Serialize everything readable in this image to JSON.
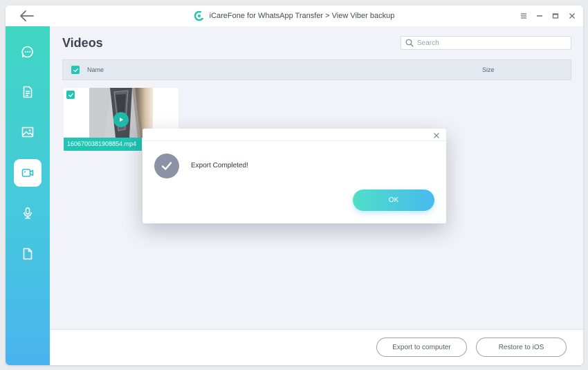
{
  "window": {
    "title": "iCareFone for WhatsApp Transfer > View Viber backup"
  },
  "sidebar": {
    "items": [
      {
        "name": "chats",
        "icon": "chat-bubble-icon",
        "active": false
      },
      {
        "name": "documents",
        "icon": "document-icon",
        "active": false
      },
      {
        "name": "photos",
        "icon": "image-icon",
        "active": false
      },
      {
        "name": "videos",
        "icon": "video-camera-icon",
        "active": true
      },
      {
        "name": "audio",
        "icon": "microphone-icon",
        "active": false
      },
      {
        "name": "files",
        "icon": "file-icon",
        "active": false
      }
    ]
  },
  "main": {
    "page_title": "Videos",
    "search": {
      "placeholder": "Search",
      "value": ""
    },
    "table": {
      "columns": [
        "Name",
        "Size"
      ],
      "select_all_checked": true
    },
    "videos": [
      {
        "filename": "1606700381908854.mp4",
        "checked": true
      }
    ]
  },
  "footer": {
    "export_label": "Export to computer",
    "restore_label": "Restore to iOS"
  },
  "dialog": {
    "message": "Export Completed!",
    "ok_label": "OK"
  },
  "colors": {
    "accent": "#20c5b3",
    "sidebar_top": "#3fd6c1",
    "sidebar_bottom": "#4ab4ee",
    "ok_gradient_start": "#4fdfc8",
    "ok_gradient_end": "#48b9ee",
    "success_icon_bg": "#8b92a3"
  }
}
